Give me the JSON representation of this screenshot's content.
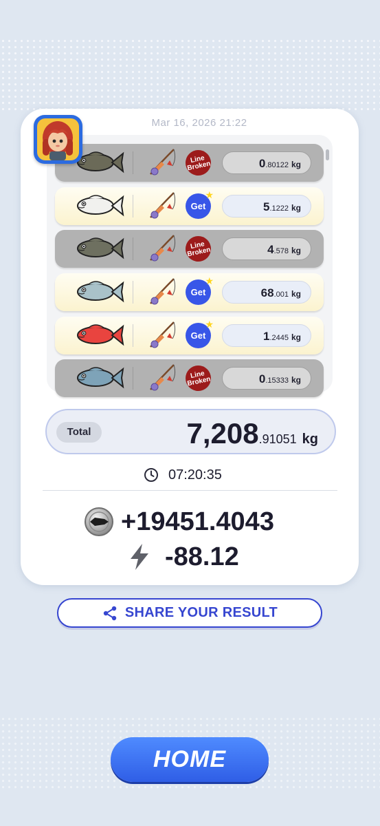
{
  "header": {
    "date": "Mar 16, 2026 21:22",
    "avatar_icon": "character-avatar-icon"
  },
  "catches": [
    {
      "fish": "brown trout",
      "fish_color": "#6b6a58",
      "status": "Line Broken",
      "status_type": "broken",
      "weight_int": "0",
      "weight_frac": ".80122",
      "unit": "kg"
    },
    {
      "fish": "white sea fish",
      "fish_color": "#f1f1ee",
      "status": "Get",
      "status_type": "get",
      "weight_int": "5",
      "weight_frac": ".1222",
      "unit": "kg"
    },
    {
      "fish": "striped bass",
      "fish_color": "#6e7060",
      "status": "Line Broken",
      "status_type": "broken",
      "weight_int": "4",
      "weight_frac": ".578",
      "unit": "kg"
    },
    {
      "fish": "spotted bass",
      "fish_color": "#a9c2c9",
      "status": "Get",
      "status_type": "get",
      "weight_int": "68",
      "weight_frac": ".001",
      "unit": "kg"
    },
    {
      "fish": "red snapper",
      "fish_color": "#e9443f",
      "status": "Get",
      "status_type": "get",
      "weight_int": "1",
      "weight_frac": ".2445",
      "unit": "kg"
    },
    {
      "fish": "sardine",
      "fish_color": "#7ea3b8",
      "status": "Line Broken",
      "status_type": "broken",
      "weight_int": "0",
      "weight_frac": ".15333",
      "unit": "kg"
    }
  ],
  "total": {
    "label": "Total",
    "value_int": "7,208",
    "value_frac": ".91051",
    "unit": "kg"
  },
  "duration": {
    "icon": "clock-icon",
    "value": "07:20:35"
  },
  "reward": {
    "icon": "coin-icon",
    "value": "+19451.4043"
  },
  "energy": {
    "icon": "lightning-icon",
    "value": "-88.12"
  },
  "buttons": {
    "share": "SHARE YOUR RESULT",
    "share_icon": "share-icon",
    "home": "HOME"
  },
  "colors": {
    "accent_blue": "#3646d0",
    "home_blue": "#2f5ee6",
    "line_broken_red": "#9c1b1b",
    "get_blue": "#3856e8"
  }
}
